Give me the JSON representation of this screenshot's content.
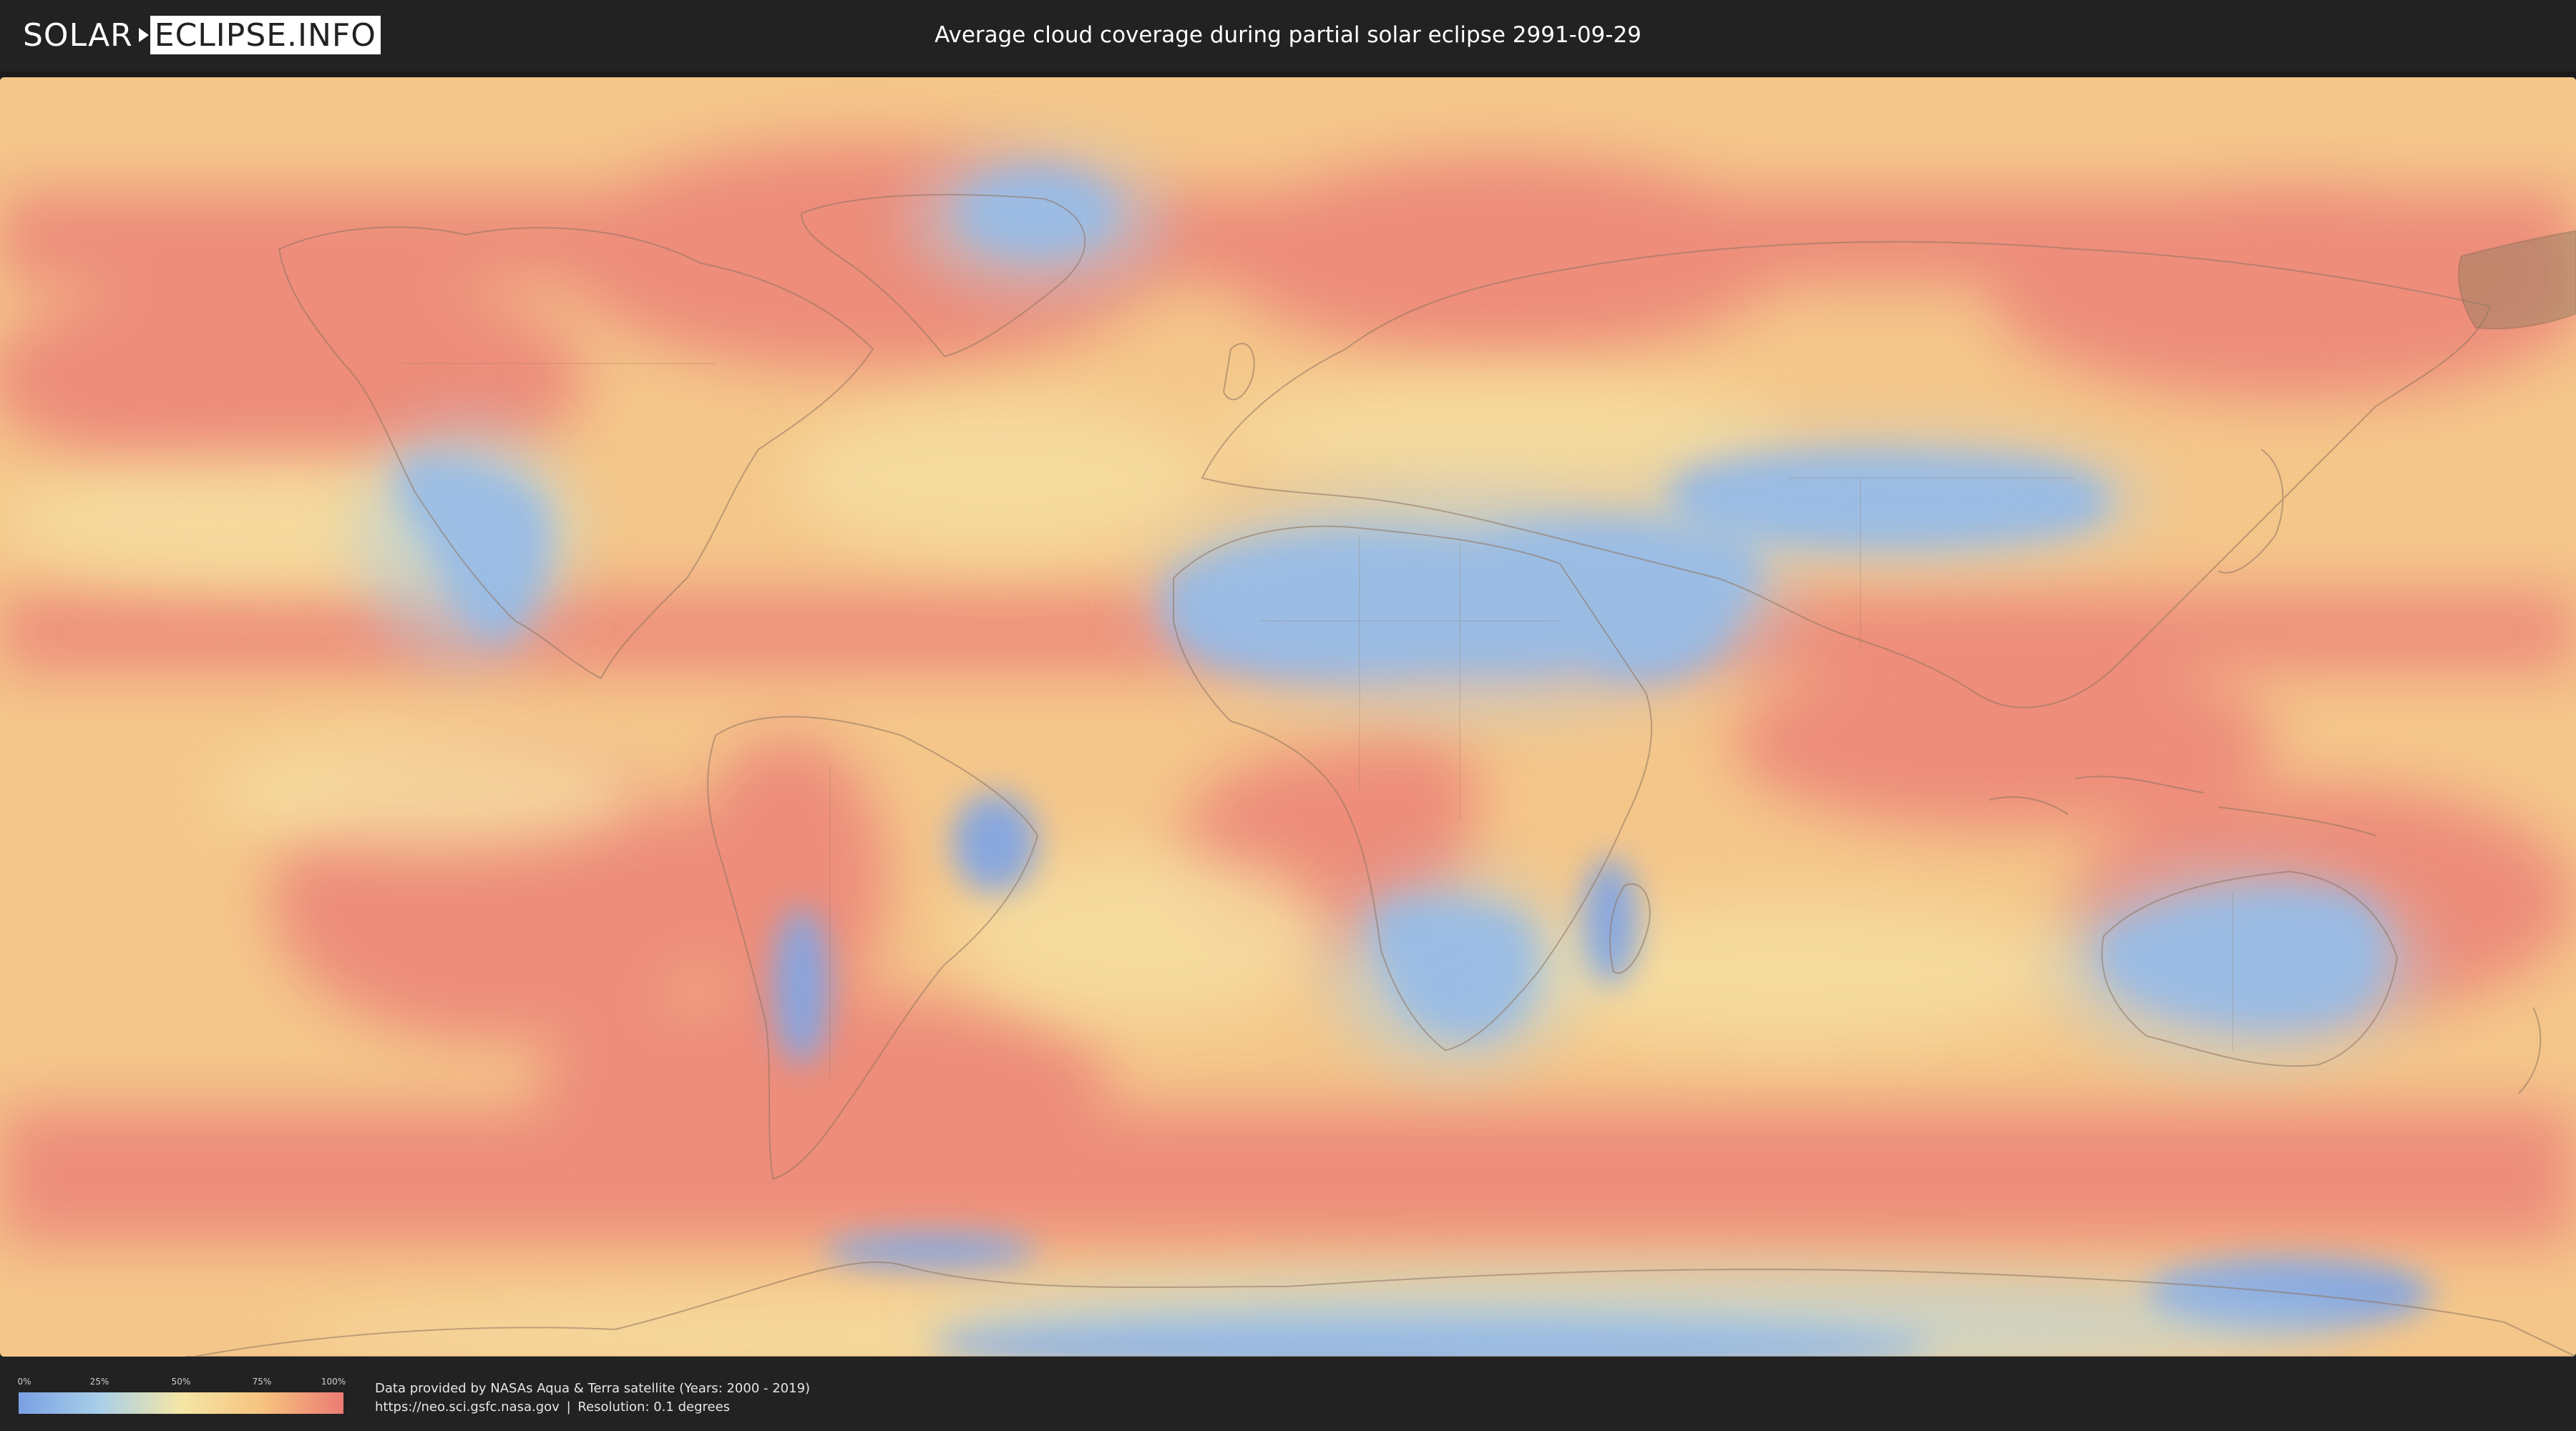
{
  "header": {
    "logo_left": "SOLAR",
    "logo_right": "ECLIPSE.INFO",
    "title": "Average cloud coverage during partial solar eclipse 2991-09-29"
  },
  "legend": {
    "ticks": [
      "0%",
      "25%",
      "50%",
      "75%",
      "100%"
    ],
    "colors": [
      "#7aa0e4",
      "#a9cfe8",
      "#f5e6a6",
      "#f6c37f",
      "#ec7b74"
    ]
  },
  "credits": {
    "line1": "Data provided by NASAs Aqua & Terra satellite (Years: 2000 - 2019)",
    "url": "https://neo.sci.gsfc.nasa.gov",
    "separator": "|",
    "resolution": "Resolution: 0.1 degrees"
  },
  "map": {
    "ocean_base_color": "#f4c486",
    "high_cloud_color": "#ec7f73",
    "low_cloud_color": "#7ea3e2",
    "mid_color": "#f5e2a4",
    "eclipse_shadow_color": "#8a7a5a"
  }
}
